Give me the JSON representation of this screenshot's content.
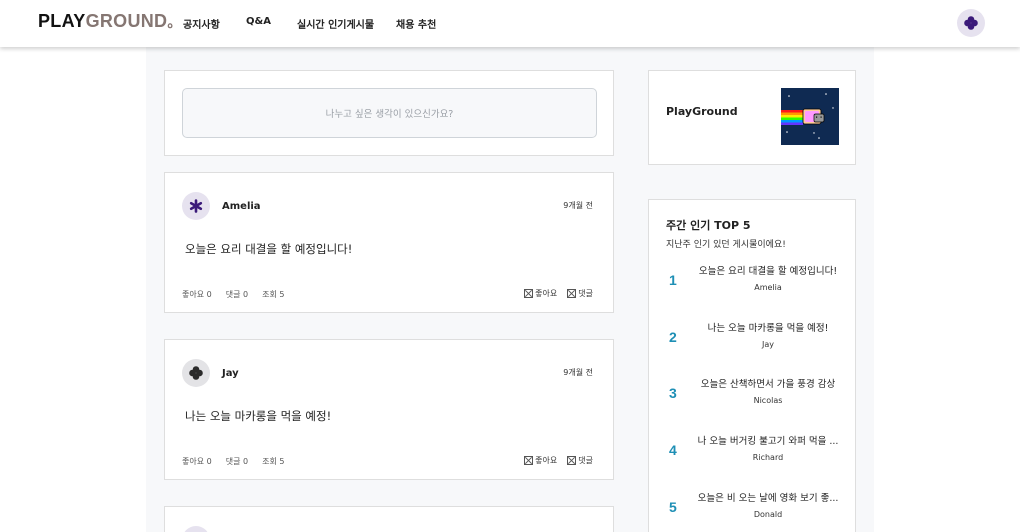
{
  "header": {
    "logo_play": "PLAY",
    "logo_ground": "GROUND",
    "logo_dot": "。",
    "nav": [
      "공지사항",
      "Q&A",
      "실시간 인기게시물",
      "채용 추천"
    ],
    "avatar_icon": "clover-icon"
  },
  "composer": {
    "placeholder": "나누고 싶은 생각이 있으신가요?"
  },
  "posts": [
    {
      "author": "Amelia",
      "time": "9개월 전",
      "content": "오늘은 요리 대결을 할 예정입니다!",
      "likes_label": "좋아요 0",
      "comments_label": "댓글 0",
      "views_label": "조회 5",
      "like_action": "좋아요",
      "comment_action": "댓글",
      "avatar_icon": "asterisk-icon",
      "avatar_bg": "#e6e2ef",
      "avatar_color": "#3b1a7a"
    },
    {
      "author": "Jay",
      "time": "9개월 전",
      "content": "나는 오늘 마카롱을 먹을 예정!",
      "likes_label": "좋아요 0",
      "comments_label": "댓글 0",
      "views_label": "조회 5",
      "like_action": "좋아요",
      "comment_action": "댓글",
      "avatar_icon": "clover-icon",
      "avatar_bg": "#e3e3e6",
      "avatar_color": "#2b2b2b"
    }
  ],
  "sidebar": {
    "brand_title": "PlayGround",
    "brand_image": "nyan-cat-image"
  },
  "top5": {
    "title": "주간 인기 TOP 5",
    "subtitle": "지난주 인기 있던 게시물이에요!",
    "items": [
      {
        "rank": "1",
        "title": "오늘은 요리 대결을 할 예정입니다!",
        "author": "Amelia"
      },
      {
        "rank": "2",
        "title": "나는 오늘 마카롱을 먹을 예정!",
        "author": "Jay"
      },
      {
        "rank": "3",
        "title": "오늘은 산책하면서 가을 풍경 감상",
        "author": "Nicolas"
      },
      {
        "rank": "4",
        "title": "나 오늘 버거킹 불고기 와퍼 먹을 ...",
        "author": "Richard"
      },
      {
        "rank": "5",
        "title": "오늘은 비 오는 날에 영화 보기 좋...",
        "author": "Donald"
      }
    ]
  },
  "colors": {
    "accent_rank": "#1e8fb5",
    "logo_ground": "#857672",
    "avatar_purple": "#3b1a7a"
  }
}
